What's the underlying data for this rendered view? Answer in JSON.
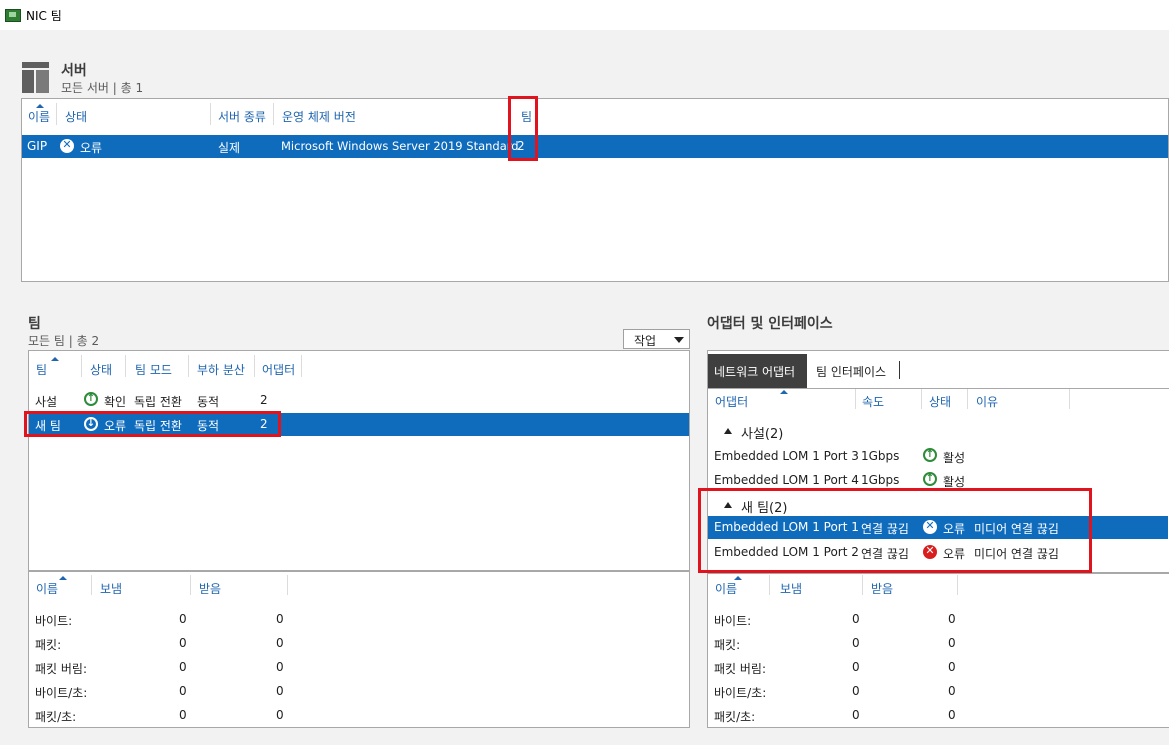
{
  "window": {
    "title": "NIC 팀"
  },
  "servers": {
    "title": "서버",
    "subtitle": "모든 서버 | 총 1",
    "columns": [
      "이름",
      "상태",
      "서버 종류",
      "운영 체제 버전",
      "팀"
    ],
    "rows": [
      {
        "name": "GIP",
        "status": "오류",
        "server_type": "실제",
        "os_version": "Microsoft Windows Server 2019 Standard",
        "teams": "2"
      }
    ]
  },
  "teams": {
    "title": "팀",
    "subtitle": "모든 팀 | 총 2",
    "tasks_label": "작업",
    "columns": [
      "팀",
      "상태",
      "팀 모드",
      "부하 분산",
      "어댑터"
    ],
    "rows": [
      {
        "team": "사설",
        "status": "확인",
        "mode": "독립 전환",
        "load_balancing": "동적",
        "adapters": "2"
      },
      {
        "team": "새 팀",
        "status": "오류",
        "mode": "독립 전환",
        "load_balancing": "동적",
        "adapters": "2"
      }
    ],
    "stats_columns": [
      "이름",
      "보냄",
      "받음"
    ],
    "stats": [
      {
        "name": "바이트:",
        "sent": "0",
        "received": "0"
      },
      {
        "name": "패킷:",
        "sent": "0",
        "received": "0"
      },
      {
        "name": "패킷 버림:",
        "sent": "0",
        "received": "0"
      },
      {
        "name": "바이트/초:",
        "sent": "0",
        "received": "0"
      },
      {
        "name": "패킷/초:",
        "sent": "0",
        "received": "0"
      }
    ]
  },
  "adapters": {
    "title": "어댑터 및 인터페이스",
    "tabs": [
      "네트워크 어댑터",
      "팀 인터페이스"
    ],
    "columns": [
      "어댑터",
      "속도",
      "상태",
      "이유"
    ],
    "groups": [
      {
        "label": "사설(2)",
        "items": [
          {
            "adapter": "Embedded LOM 1 Port 3",
            "speed": "1Gbps",
            "status": "활성",
            "reason": ""
          },
          {
            "adapter": "Embedded LOM 1 Port 4",
            "speed": "1Gbps",
            "status": "활성",
            "reason": ""
          }
        ]
      },
      {
        "label": "새 팀(2)",
        "items": [
          {
            "adapter": "Embedded LOM 1 Port 1",
            "speed": "연결 끊김",
            "status": "오류",
            "reason": "미디어 연결 끊김"
          },
          {
            "adapter": "Embedded LOM 1 Port 2",
            "speed": "연결 끊김",
            "status": "오류",
            "reason": "미디어 연결 끊김"
          }
        ]
      }
    ],
    "stats_columns": [
      "이름",
      "보냄",
      "받음"
    ],
    "stats": [
      {
        "name": "바이트:",
        "sent": "0",
        "received": "0"
      },
      {
        "name": "패킷:",
        "sent": "0",
        "received": "0"
      },
      {
        "name": "패킷 버림:",
        "sent": "0",
        "received": "0"
      },
      {
        "name": "바이트/초:",
        "sent": "0",
        "received": "0"
      },
      {
        "name": "패킷/초:",
        "sent": "0",
        "received": "0"
      }
    ]
  },
  "colors": {
    "selection": "#0f6cbd",
    "header_text": "#1f65b0",
    "highlight_box": "#e0141e",
    "ok": "#2e8b3a",
    "error": "#d81e1e"
  }
}
